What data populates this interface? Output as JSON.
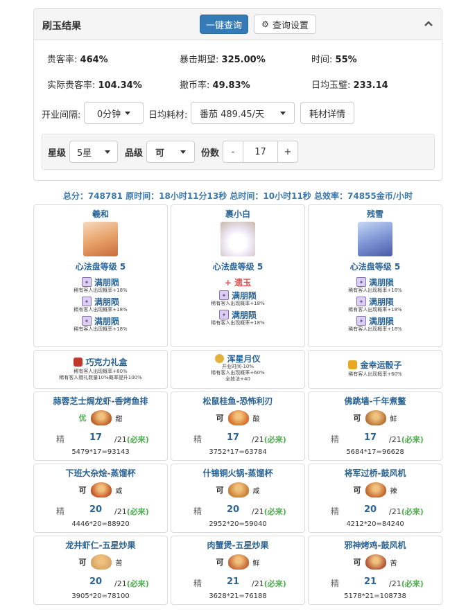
{
  "header": {
    "title": "刷玉结果",
    "query_btn": "一键查询",
    "settings_btn": "查询设置"
  },
  "stats": {
    "guest_rate_label": "贵客率:",
    "guest_rate": "464%",
    "crit_label": "暴击期望:",
    "crit": "325.00%",
    "time_label": "时间:",
    "time": "55%",
    "real_guest_label": "实际贵客率:",
    "real_guest": "104.34%",
    "withdraw_label": "撤币率:",
    "withdraw": "49.83%",
    "daily_jade_label": "日均玉璧:",
    "daily_jade": "233.14"
  },
  "controls": {
    "open_interval_label": "开业间隔:",
    "open_interval": "0分钟",
    "daily_cost_label": "日均耗材:",
    "daily_cost": "番茄 489.45/天",
    "cost_detail": "耗材详情",
    "star_label": "星级",
    "star": "5星",
    "grade_label": "品级",
    "grade": "可",
    "copies_label": "份数",
    "copies": "17",
    "minus": "-",
    "plus": "+"
  },
  "summary": "总分：748781 原时间：18小时11分13秒 总时间：10小时11秒 总效率：74855金币/小时",
  "chefs": [
    {
      "name": "羲和",
      "level": "心法盘等级 5",
      "extra": "",
      "skills": [
        {
          "name": "满朋陨",
          "desc": "稀有客人出现概率+18%"
        },
        {
          "name": "满朋陨",
          "desc": "稀有客人出现概率+18%"
        },
        {
          "name": "满朋陨",
          "desc": "稀有客人出现概率+18%"
        }
      ]
    },
    {
      "name": "裹小白",
      "level": "心法盘等级 5",
      "extra": "+ 遗玉",
      "skills": [
        {
          "name": "满朋陨",
          "desc": "稀有客人出现概率+18%"
        },
        {
          "name": "满朋陨",
          "desc": "稀有客人出现概率+18%"
        }
      ]
    },
    {
      "name": "残雪",
      "level": "心法盘等级 5",
      "extra": "",
      "skills": [
        {
          "name": "满朋陨",
          "desc": "稀有客人出现概率+18%"
        },
        {
          "name": "满朋陨",
          "desc": "稀有客人出现概率+18%"
        },
        {
          "name": "满朋陨",
          "desc": "稀有客人出现概率+18%"
        }
      ]
    }
  ],
  "equips": [
    {
      "name": "巧克力礼盒",
      "lines": [
        "稀有客人出现概率+80%",
        "稀有客人赠礼数量10%概率提升100%"
      ]
    },
    {
      "name": "浑星月仪",
      "lines": [
        "开业时间-10%",
        "稀有客人出现概率+60%",
        "全技法+40"
      ]
    },
    {
      "name": "金幸运骰子",
      "lines": [
        "稀有客人出现概率+60%"
      ]
    }
  ],
  "dishes": [
    {
      "title": "蒜蓉芝士焗龙虾-香烤鱼排",
      "grade": "优",
      "flavor": "甜",
      "jing": "精",
      "count": "17",
      "max": "/21",
      "must": "(必来)",
      "formula": "5479*17=93143",
      "color": "#c0612b"
    },
    {
      "title": "松鼠桂鱼-恐怖利刃",
      "grade": "可",
      "flavor": "酸",
      "jing": "精",
      "count": "17",
      "max": "/21",
      "must": "(必来)",
      "formula": "3752*17=63784",
      "color": "#d9702e"
    },
    {
      "title": "佛跳墙-千年煮鳖",
      "grade": "可",
      "flavor": "鲜",
      "jing": "精",
      "count": "17",
      "max": "/21",
      "must": "(必来)",
      "formula": "5684*17=96628",
      "color": "#b8763a"
    },
    {
      "title": "下班大杂烩-蒸馏杯",
      "grade": "可",
      "flavor": "咸",
      "jing": "精",
      "count": "20",
      "max": "/21",
      "must": "(必来)",
      "formula": "4446*20=88920",
      "color": "#c85a2a"
    },
    {
      "title": "什锦铜火锅-蒸馏杯",
      "grade": "可",
      "flavor": "咸",
      "jing": "精",
      "count": "20",
      "max": "/21",
      "must": "(必来)",
      "formula": "2952*20=59040",
      "color": "#c9803a"
    },
    {
      "title": "将军过桥-鼓风机",
      "grade": "可",
      "flavor": "辣",
      "jing": "精",
      "count": "20",
      "max": "/21",
      "must": "(必来)",
      "formula": "4212*20=84240",
      "color": "#c46a30"
    },
    {
      "title": "龙井虾仁-五星炒果",
      "grade": "可",
      "flavor": "苦",
      "jing": "",
      "count": "20",
      "max": "/21",
      "must": "(必来)",
      "formula": "3905*20=78100",
      "color": "#d9a86a"
    },
    {
      "title": "肉蟹煲-五星炒果",
      "grade": "可",
      "flavor": "鲜",
      "jing": "精",
      "count": "21",
      "max": "/21",
      "must": "(必来)",
      "formula": "3628*21=76188",
      "color": "#c76a3a"
    },
    {
      "title": "邪神烤鸡-鼓风机",
      "grade": "可",
      "flavor": "苦",
      "jing": "精",
      "count": "21",
      "max": "/21",
      "must": "(必来)",
      "formula": "5178*21=108738",
      "color": "#b45a3a"
    }
  ]
}
